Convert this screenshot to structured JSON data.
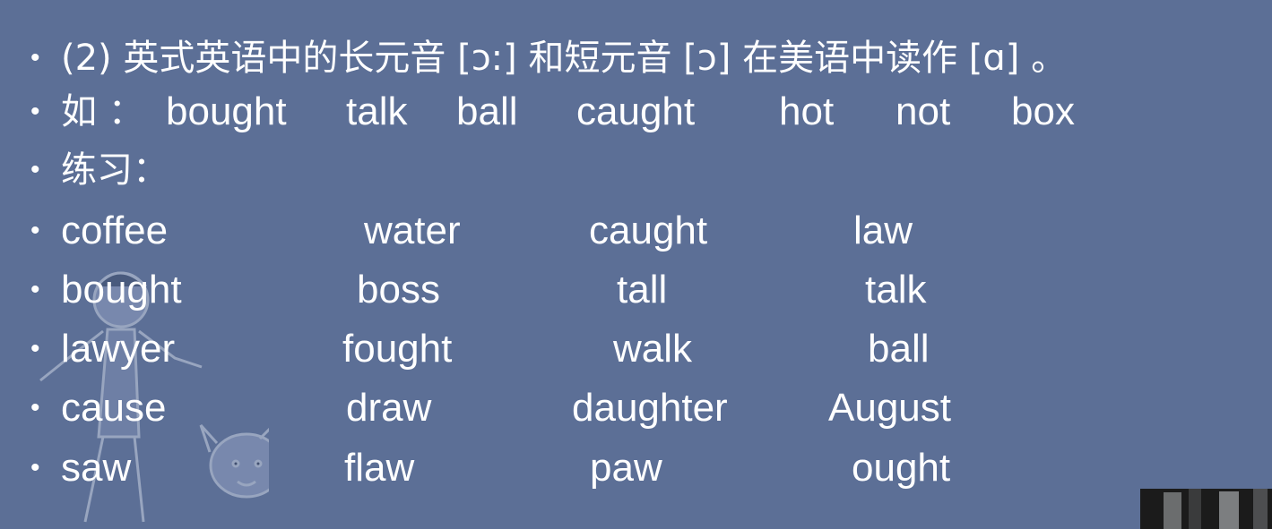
{
  "bullet_char": "•",
  "rule": {
    "text": "(2)  英式英语中的长元音 [ɔ:] 和短元音 [ɔ] 在美语中读作 [ɑ] 。"
  },
  "example": {
    "label": "如 ：",
    "words": [
      "bought",
      "talk",
      "ball",
      "caught",
      "hot",
      "not",
      "box"
    ]
  },
  "practice": {
    "label": "练习：",
    "rows": [
      [
        "coffee",
        "water",
        "caught",
        "law"
      ],
      [
        "bought",
        "boss",
        "tall",
        "talk"
      ],
      [
        "lawyer",
        "fought",
        "walk",
        "ball"
      ],
      [
        "cause",
        "draw",
        "daughter",
        "August"
      ],
      [
        "saw",
        "flaw",
        "paw",
        "ought"
      ]
    ]
  },
  "colors": {
    "background": "#5c6f96",
    "text": "#ffffff"
  }
}
